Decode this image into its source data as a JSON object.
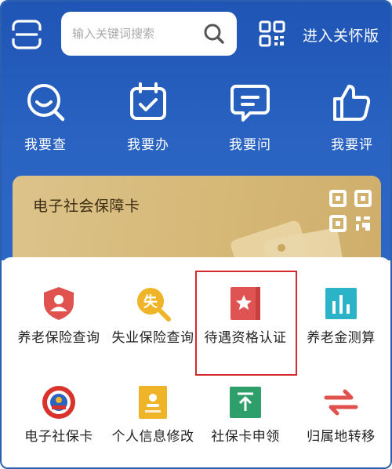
{
  "search": {
    "placeholder": "输入关键词搜索"
  },
  "header": {
    "care_link": "进入关怀版"
  },
  "quick_actions": [
    {
      "label": "我要查",
      "icon": "search-face-icon"
    },
    {
      "label": "我要办",
      "icon": "calendar-check-icon"
    },
    {
      "label": "我要问",
      "icon": "chat-bubble-icon"
    },
    {
      "label": "我要评",
      "icon": "thumbs-up-icon"
    }
  ],
  "card": {
    "title": "电子社会保障卡"
  },
  "services": [
    {
      "label": "养老保险查询",
      "icon": "shield-person-icon",
      "color": "#e0524e"
    },
    {
      "label": "失业保险查询",
      "icon": "unemployment-search-icon",
      "color": "#f0b429"
    },
    {
      "label": "待遇资格认证",
      "icon": "star-book-icon",
      "color": "#e05353",
      "highlighted": true
    },
    {
      "label": "养老金测算",
      "icon": "bar-chart-icon",
      "color": "#2bb3c8"
    },
    {
      "label": "电子社保卡",
      "icon": "badge-emblem-icon",
      "color": "#d8342d"
    },
    {
      "label": "个人信息修改",
      "icon": "id-card-icon",
      "color": "#f0b429"
    },
    {
      "label": "社保卡申领",
      "icon": "download-tray-icon",
      "color": "#2e9f6a"
    },
    {
      "label": "归属地转移",
      "icon": "transfer-arrows-icon",
      "color": "#e0524e"
    }
  ],
  "colors": {
    "brand_blue": "#2a63c2",
    "card_gold": "#d6b877",
    "highlight_red": "#d42a2a"
  }
}
